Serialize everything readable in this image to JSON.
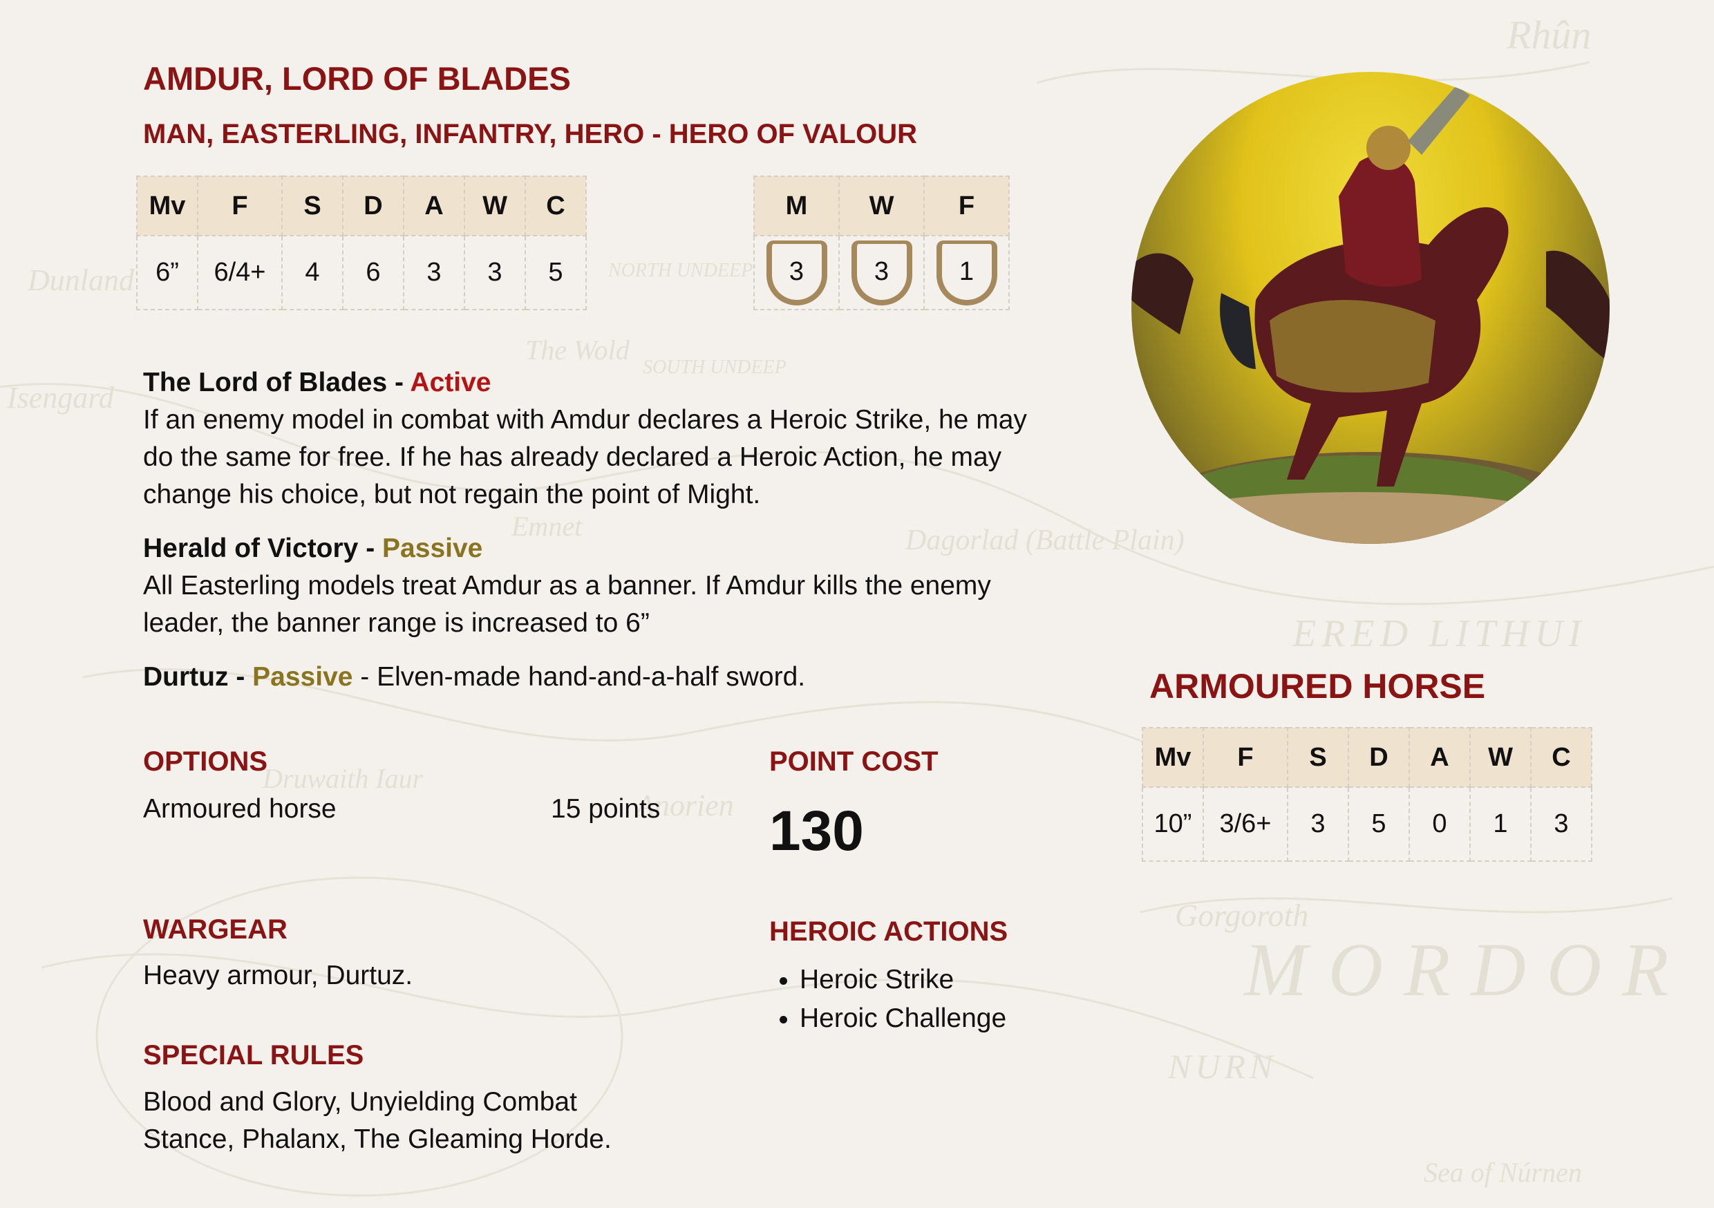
{
  "profile": {
    "name": "AMDUR, LORD OF BLADES",
    "keywords": "MAN, EASTERLING, INFANTRY, HERO - HERO OF VALOUR",
    "stat_headers": [
      "Mv",
      "F",
      "S",
      "D",
      "A",
      "W",
      "C"
    ],
    "stat_values": [
      "6”",
      "6/4+",
      "4",
      "6",
      "3",
      "3",
      "5"
    ],
    "mwf_headers": [
      "M",
      "W",
      "F"
    ],
    "mwf_values": [
      "3",
      "3",
      "1"
    ]
  },
  "special_abilities": [
    {
      "name": "The Lord of Blades",
      "sep": " - ",
      "type": "Active",
      "text": "If an enemy model in combat with Amdur declares a Heroic Strike, he may do the same for free. If he has already declared a Heroic Action, he may change his choice, but not regain the point of Might."
    },
    {
      "name": "Herald of Victory",
      "sep": " - ",
      "type": "Passive",
      "text": "All Easterling models treat Amdur as a banner. If Amdur kills the enemy leader, the banner range is increased to 6”"
    },
    {
      "name": "Durtuz",
      "sep": " - ",
      "type": "Passive",
      "text": " - Elven-made hand-and-a-half sword."
    }
  ],
  "options": {
    "heading": "OPTIONS",
    "items": [
      {
        "label": "Armoured horse",
        "cost": "15 points"
      }
    ]
  },
  "point_cost": {
    "heading": "POINT COST",
    "value": "130"
  },
  "wargear": {
    "heading": "WARGEAR",
    "text": "Heavy armour, Durtuz."
  },
  "heroic_actions": {
    "heading": "HEROIC ACTIONS",
    "items": [
      "Heroic Strike",
      "Heroic Challenge"
    ]
  },
  "special_rules": {
    "heading": "SPECIAL RULES",
    "text": "Blood and Glory, Unyielding Combat Stance, Phalanx, The Gleaming Horde."
  },
  "mount": {
    "name": "ARMOURED HORSE",
    "stat_headers": [
      "Mv",
      "F",
      "S",
      "D",
      "A",
      "W",
      "C"
    ],
    "stat_values": [
      "10”",
      "3/6+",
      "3",
      "5",
      "0",
      "1",
      "3"
    ]
  },
  "map_labels": [
    "Rhûn",
    "Isengard",
    "Dagorlad (Battle Plain)",
    "ERED LITHUI",
    "MORDOR",
    "Gorgoroth",
    "NURN",
    "Sea of Núrnen",
    "Emnet",
    "The Wold",
    "NORTH UNDEEP",
    "SOUTH UNDEEP",
    "Anorien",
    "Druwaith Iaur",
    "Dunland"
  ],
  "colors": {
    "accent": "#8a1414",
    "active": "#b51414",
    "passive": "#8a7420",
    "header_bg": "#efe2cf",
    "shield": "#a5885c"
  }
}
